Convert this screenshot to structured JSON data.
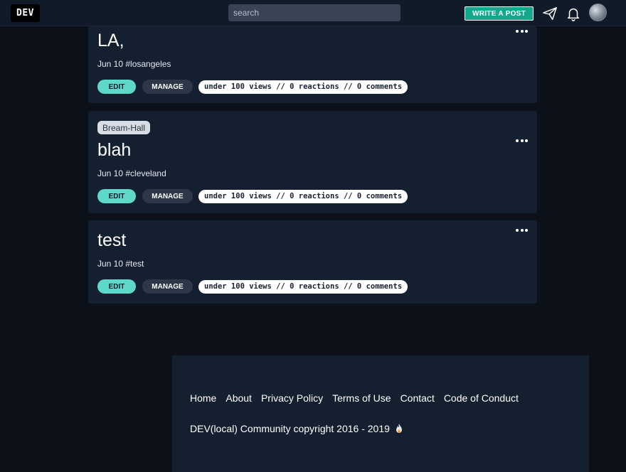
{
  "header": {
    "logo": "DEV",
    "search_placeholder": "search",
    "write_post_label": "WRITE A POST",
    "icons": [
      "send-icon",
      "bell-icon",
      "avatar"
    ]
  },
  "posts": [
    {
      "org": "",
      "title": "LA,",
      "meta": "Jun 10 #losangeles",
      "edit_label": "EDIT",
      "manage_label": "MANAGE",
      "stats": "under 100 views // 0 reactions // 0 comments"
    },
    {
      "org": "Bream-Hall",
      "title": "blah",
      "meta": "Jun 10 #cleveland",
      "edit_label": "EDIT",
      "manage_label": "MANAGE",
      "stats": "under 100 views // 0 reactions // 0 comments"
    },
    {
      "org": "",
      "title": "test",
      "meta": "Jun 10 #test",
      "edit_label": "EDIT",
      "manage_label": "MANAGE",
      "stats": "under 100 views // 0 reactions // 0 comments"
    }
  ],
  "footer": {
    "links": [
      "Home",
      "About",
      "Privacy Policy",
      "Terms of Use",
      "Contact",
      "Code of Conduct"
    ],
    "copyright": "DEV(local) Community copyright 2016 - 2019"
  },
  "colors": {
    "accent": "#13a88d",
    "edit_button": "#5ed9c9",
    "card_bg": "#141f2f",
    "page_bg": "#0b1019"
  }
}
